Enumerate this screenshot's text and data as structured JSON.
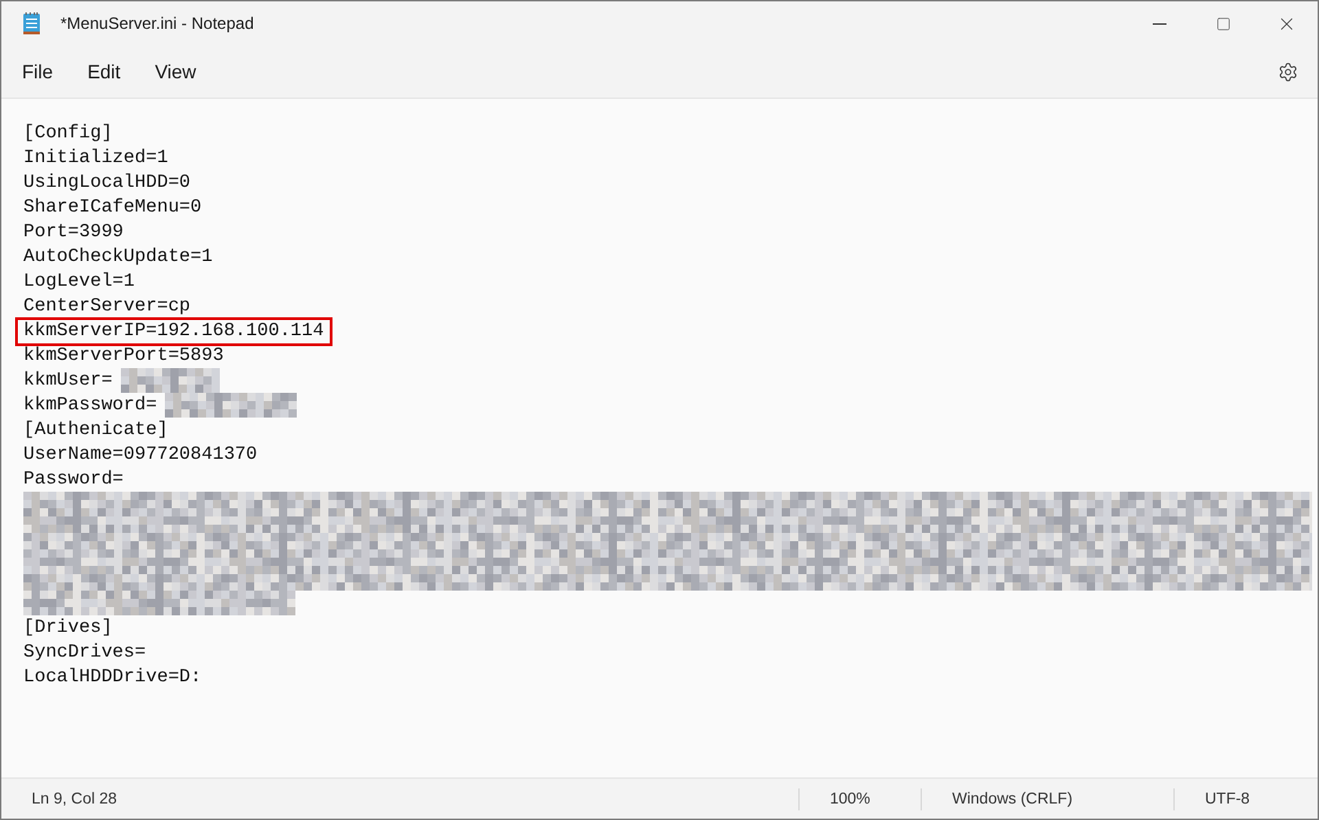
{
  "window": {
    "title": "*MenuServer.ini - Notepad"
  },
  "menu": [
    {
      "label": "File"
    },
    {
      "label": "Edit"
    },
    {
      "label": "View"
    }
  ],
  "lines": [
    {
      "kind": "text",
      "text": "[Config]",
      "highlighted": false
    },
    {
      "kind": "text",
      "text": "Initialized=1",
      "highlighted": false
    },
    {
      "kind": "text",
      "text": "UsingLocalHDD=0",
      "highlighted": false
    },
    {
      "kind": "text",
      "text": "ShareICafeMenu=0",
      "highlighted": false
    },
    {
      "kind": "text",
      "text": "Port=3999",
      "highlighted": false
    },
    {
      "kind": "text",
      "text": "AutoCheckUpdate=1",
      "highlighted": false
    },
    {
      "kind": "text",
      "text": "LogLevel=1",
      "highlighted": false
    },
    {
      "kind": "text",
      "text": "CenterServer=cp",
      "highlighted": false
    },
    {
      "kind": "text",
      "text": "kkmServerIP=192.168.100.114",
      "highlighted": true
    },
    {
      "kind": "text",
      "text": "kkmServerPort=5893",
      "highlighted": false
    },
    {
      "kind": "masked",
      "text": "kkmUser=",
      "highlighted": false
    },
    {
      "kind": "masked",
      "text": "kkmPassword=",
      "highlighted": false
    },
    {
      "kind": "text",
      "text": "[Authenicate]",
      "highlighted": false
    },
    {
      "kind": "text",
      "text": "UserName=097720841370",
      "highlighted": false
    },
    {
      "kind": "text",
      "text": "Password=",
      "highlighted": false
    },
    {
      "kind": "mask"
    },
    {
      "kind": "text",
      "text": "[Drives]",
      "highlighted": false
    },
    {
      "kind": "text",
      "text": "SyncDrives=",
      "highlighted": false
    },
    {
      "kind": "text",
      "text": "LocalHDDDrive=D:",
      "highlighted": false
    }
  ],
  "status_bar": {
    "position": "Ln 9, Col 28",
    "zoom": "100%",
    "line_ending": "Windows (CRLF)",
    "encoding": "UTF-8"
  }
}
